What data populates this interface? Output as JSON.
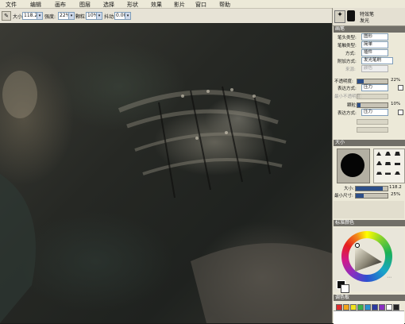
{
  "menu": [
    "文件",
    "编辑",
    "画布",
    "图层",
    "选择",
    "形状",
    "效果",
    "影片",
    "窗口",
    "帮助"
  ],
  "toolbar": {
    "size_label": "大小:",
    "size_value": "118.2",
    "opacity_label": "强度:",
    "opacity_value": "22%",
    "grain_label": "颗粒:",
    "grain_value": "10%",
    "jitter_label": "抖动:",
    "jitter_value": "0.00",
    "brush_category": "特效笔",
    "brush_variant": "发光"
  },
  "brush_panel": {
    "header": "画笔",
    "rows": [
      {
        "label": "笔头类型:",
        "value": "图形",
        "dim": false
      },
      {
        "label": "笔触类型:",
        "value": "简单",
        "dim": false
      },
      {
        "label": "方式:",
        "value": "插件",
        "dim": false
      },
      {
        "label": "附加方式:",
        "value": "发光笔刷",
        "dim": false
      },
      {
        "label": "来源:",
        "value": "颜色",
        "dim": true
      }
    ]
  },
  "opacity_panel": {
    "opacity_label": "不透明度:",
    "opacity_value": "22%",
    "opacity_fraction": 0.22,
    "expr_label": "表达方式:",
    "expr_value": "压力",
    "min_opacity_label": "最小不透明度:",
    "grain_label": "颗粒:",
    "grain_value": "10%",
    "grain_fraction": 0.1,
    "grain_expr_label": "表达方式:",
    "grain_expr_value": "压力"
  },
  "size_panel": {
    "header": "大小",
    "size_label": "大小:",
    "size_value": "118.2",
    "min_size_label": "最小尺寸:",
    "min_size_value": "25%",
    "size_fraction": 0.85,
    "min_size_fraction": 0.25
  },
  "color_panel": {
    "header": "标准颜色"
  },
  "swatch_panel": {
    "header": "调色板"
  },
  "swatches": [
    "#e02b2b",
    "#f2a51c",
    "#f2e21c",
    "#3bb04a",
    "#2a8fd0",
    "#2a3aa0",
    "#8a2fc0",
    "#ffffff",
    "#222222"
  ]
}
